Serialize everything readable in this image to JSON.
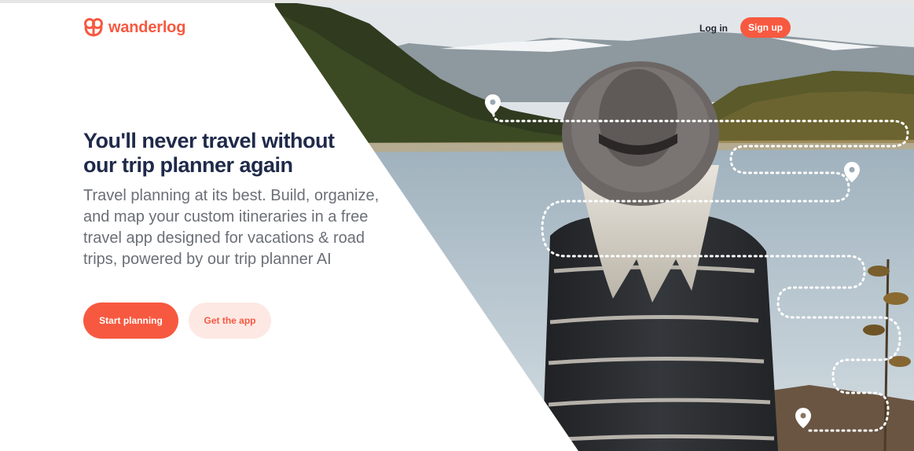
{
  "header": {
    "brand": "wanderlog",
    "login_label": "Log in",
    "signup_label": "Sign up"
  },
  "hero": {
    "title_line1": "You'll never travel without",
    "title_line2": "our trip planner again",
    "description": "Travel planning at its best. Build, organize, and map your custom itineraries in a free travel app designed for vacations & road trips, powered by our trip planner AI",
    "primary_cta": "Start planning",
    "secondary_cta": "Get the app"
  },
  "colors": {
    "brand": "#f75940",
    "brand_light": "#fde8e4",
    "heading": "#1f2a4a",
    "body_text": "#6b6f76"
  },
  "icons": {
    "logo": "wanderlog-logo-icon",
    "pin": "map-pin-icon"
  }
}
